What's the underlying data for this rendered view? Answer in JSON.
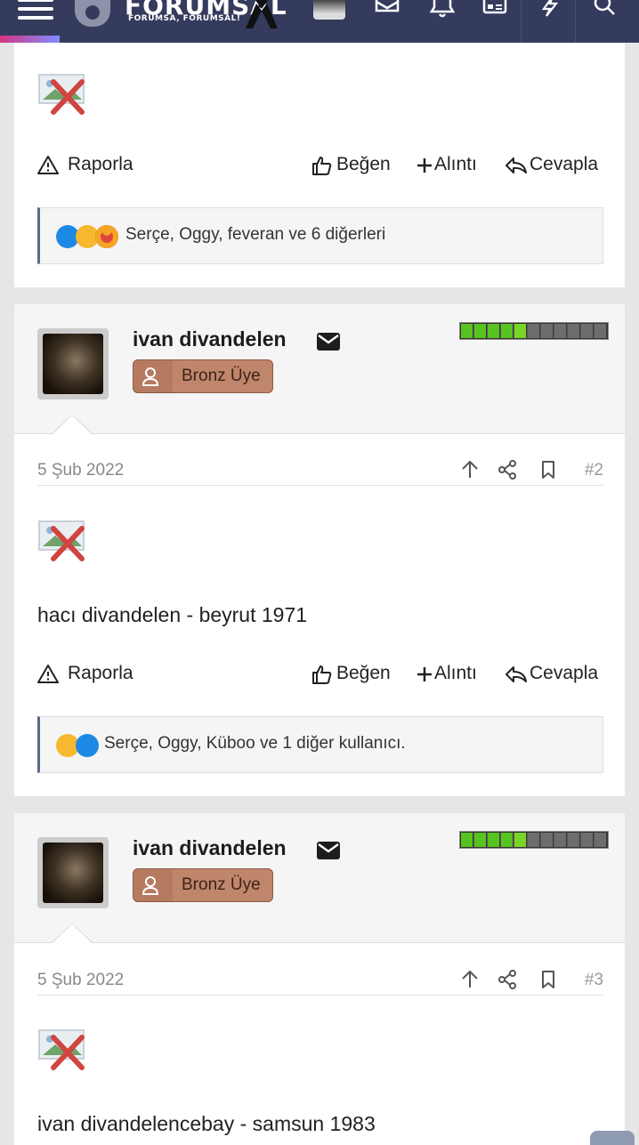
{
  "header": {
    "logo_text": "FORUMSAL",
    "logo_tagline": "FORUMSA, FORUMSAL!",
    "icons": [
      "menu-icon",
      "avatar",
      "mail-icon",
      "bell-icon",
      "news-icon",
      "bolt-icon",
      "search-icon"
    ]
  },
  "actions": {
    "report": "Raporla",
    "like": "Beğen",
    "quote": "Alıntı",
    "reply": "Cevapla"
  },
  "post1_tail": {
    "reactions_text": "Serçe, Oggy, feveran ve 6 diğerleri"
  },
  "posts": [
    {
      "username": "ivan divandelen",
      "rank": "Bronz Üye",
      "date": "5 Şub 2022",
      "number": "#2",
      "text": "hacı divandelen - beyrut 1971",
      "reactions_text": "Serçe, Oggy, Küboo ve 1 diğer kullanıcı."
    },
    {
      "username": "ivan divandelen",
      "rank": "Bronz Üye",
      "date": "5 Şub 2022",
      "number": "#3",
      "text": "ivan divandelencebay - samsun 1983"
    }
  ],
  "colors": {
    "header_bg": "#353b5c",
    "rank_badge": "#c0866b",
    "level_green": "#52c41a",
    "reaction_border": "#5a6a8a"
  },
  "user_level_fraction": 0.45
}
